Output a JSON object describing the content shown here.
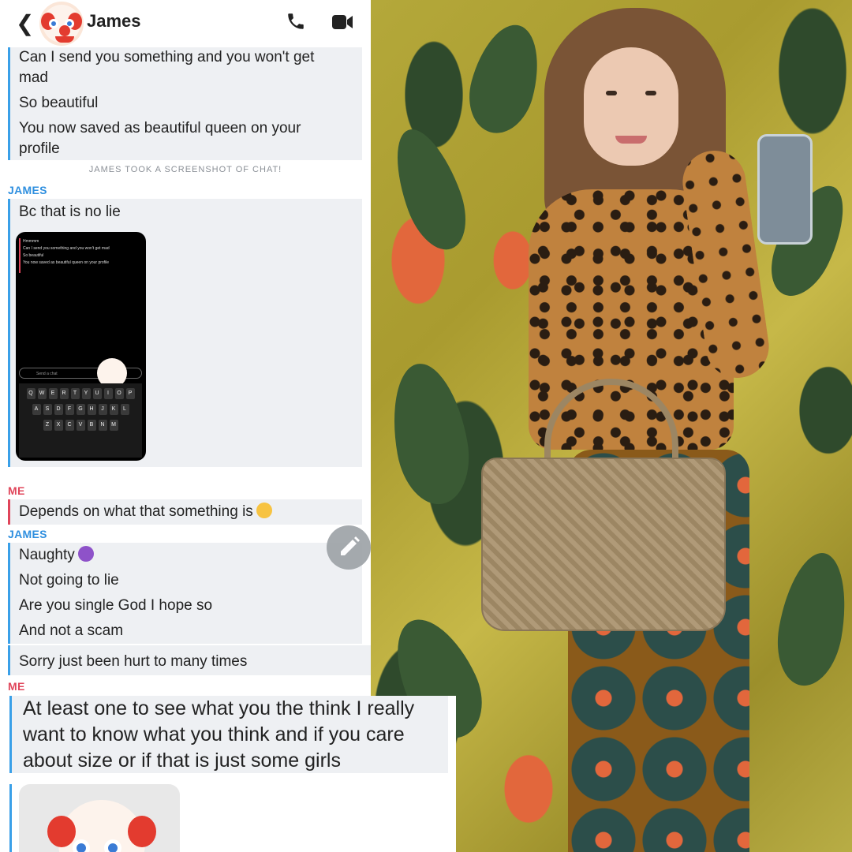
{
  "header": {
    "contact_name": "James",
    "back_icon": "chevron-left-icon",
    "call_icon": "phone-icon",
    "video_icon": "video-camera-icon"
  },
  "messages": {
    "block1": [
      "Can I send you something and you won't get",
      "mad",
      "So beautiful",
      "You now saved as beautiful queen on your",
      "profile"
    ],
    "notice": "JAMES TOOK A SCREENSHOT OF CHAT!",
    "sender_james": "JAMES",
    "sender_me": "ME",
    "block2": "Bc that is no lie",
    "me1": "Depends on what that something is",
    "block3": [
      "Naughty",
      "Not going to lie",
      "Are you single God I hope so",
      "And not a scam"
    ],
    "block4": "Sorry just been hurt to many times",
    "me2": [
      "At least one to see what you the think I really",
      "want to know what you think and if you care",
      "about size or if that is just some girls"
    ]
  },
  "screenshot_thumb": {
    "lines": [
      "Hmmmm",
      "Can I send you something and you won't get mad",
      "So beautiful",
      "You now saved as beautiful queen on your profile"
    ],
    "input_placeholder": "Send a chat",
    "kbd_row1": [
      "Q",
      "W",
      "E",
      "R",
      "T",
      "Y",
      "U",
      "I",
      "O",
      "P"
    ],
    "kbd_row2": [
      "A",
      "S",
      "D",
      "F",
      "G",
      "H",
      "J",
      "K",
      "L"
    ],
    "kbd_row3": [
      "Z",
      "X",
      "C",
      "V",
      "B",
      "N",
      "M"
    ]
  },
  "colors": {
    "james_accent": "#2f8fdf",
    "me_accent": "#e0455a",
    "bubble_bg": "#eef0f3"
  }
}
